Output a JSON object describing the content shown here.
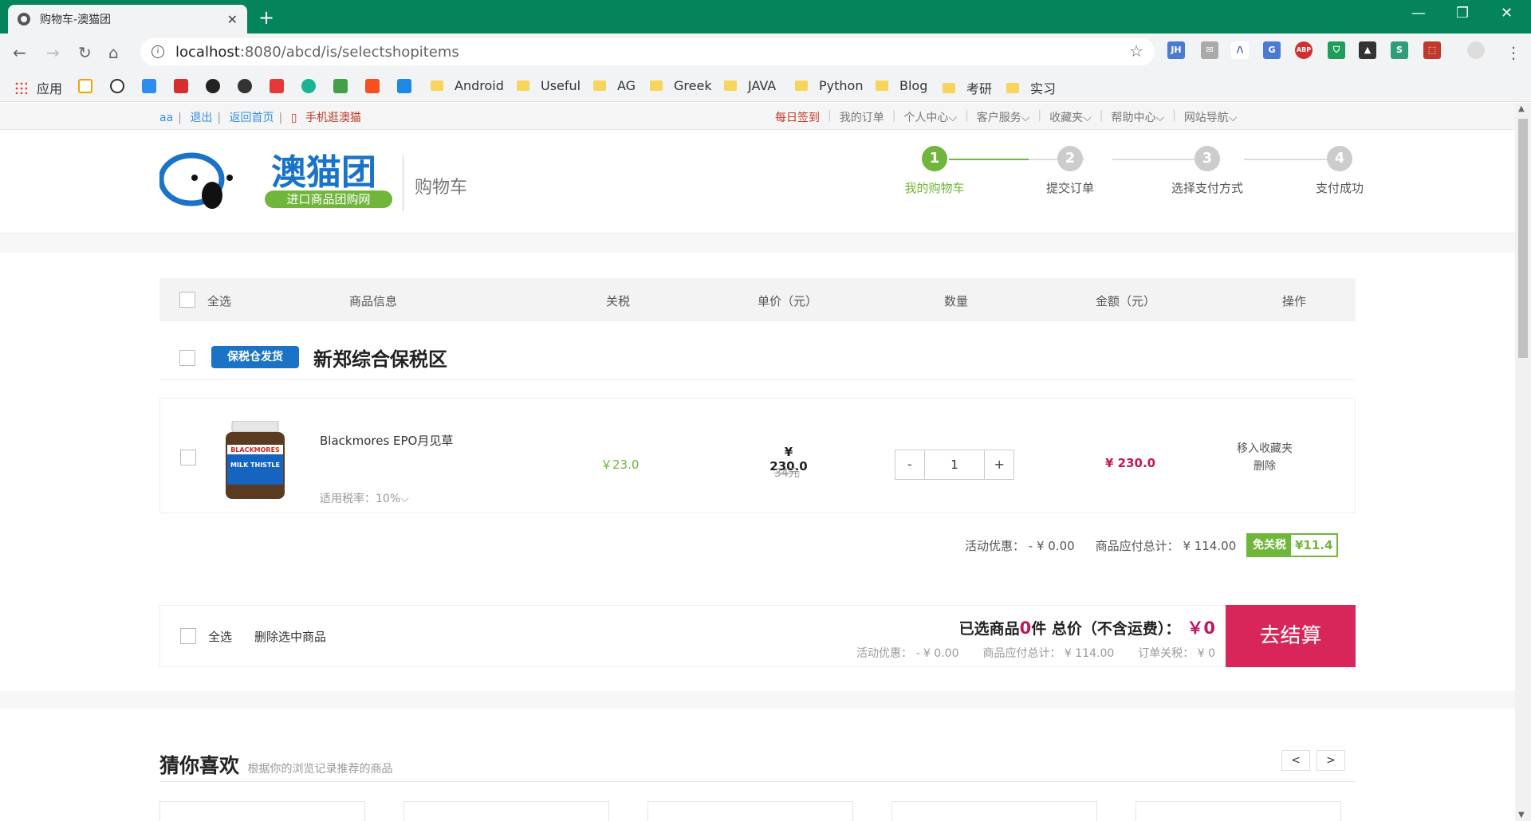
{
  "browser": {
    "tab_title": "购物车-澳猫团",
    "tab_close": "✕",
    "new_tab": "+",
    "url_host": "localhost",
    "url_path": ":8080/abcd/is/selectshopitems",
    "win_min": "—",
    "win_restore": "❐",
    "win_close": "✕",
    "nav_back": "←",
    "nav_forward": "→",
    "nav_reload": "↻",
    "nav_home": "⌂",
    "star": "☆",
    "bookmarks": {
      "apps_label": "应用",
      "folders": [
        "Android",
        "Useful",
        "AG",
        "Greek",
        "JAVA",
        "Python",
        "Blog",
        "考研",
        "实习"
      ]
    },
    "extensions": [
      "JH",
      "✉",
      "/\\",
      "G",
      "ABP",
      "⛉",
      "▲",
      "S",
      "⬚"
    ]
  },
  "topbar": {
    "user": "aa",
    "logout": "退出",
    "home": "返回首页",
    "mobile": "手机逛澳猫",
    "daily_sign": "每日签到",
    "my_orders": "我的订单",
    "personal": "个人中心",
    "service": "客户服务",
    "favorites": "收藏夹",
    "help": "帮助中心",
    "site_nav": "网站导航",
    "dropdown_glyph": "⌵"
  },
  "header": {
    "logo_text": "澳猫团",
    "logo_sub": "进口商品团购网",
    "title": "购物车",
    "steps": [
      {
        "num": "1",
        "label": "我的购物车"
      },
      {
        "num": "2",
        "label": "提交订单"
      },
      {
        "num": "3",
        "label": "选择支付方式"
      },
      {
        "num": "4",
        "label": "支付成功"
      }
    ]
  },
  "cart_head": {
    "select_all": "全选",
    "product_info": "商品信息",
    "tariff": "关税",
    "unit_price": "单价（元）",
    "quantity": "数量",
    "amount": "金额（元）",
    "operation": "操作"
  },
  "store": {
    "badge": "保税仓发货",
    "name": "新郑综合保税区"
  },
  "item": {
    "name": "Blackmores EPO月见草",
    "tax_rate": "适用税率：10%",
    "tariff": "￥23.0",
    "unit_price": "¥ 230.0",
    "old_price": "34元",
    "qty_minus": "-",
    "qty": "1",
    "qty_plus": "+",
    "amount": "¥ 230.0",
    "move_fav": "移入收藏夹",
    "delete": "删除",
    "img_brand": "BLACKMORES",
    "img_product": "MILK THISTLE"
  },
  "store_summary": {
    "discount": "活动优惠： - ¥ 0.00",
    "total": "商品应付总计： ¥ 114.00",
    "tax_free_label": "免关税",
    "tax_free_value": "¥11.4"
  },
  "checkout": {
    "select_all": "全选",
    "delete_selected": "删除选中商品",
    "selected_prefix": "已选商品",
    "selected_count": "0",
    "selected_suffix": "件 总价（不含运费）：",
    "total": "￥0",
    "discount": "活动优惠： - ¥ 0.00",
    "payable": "商品应付总计： ¥ 114.00",
    "order_tax": "订单关税： ¥ 0",
    "pay_button": "去结算"
  },
  "guess": {
    "title": "猜你喜欢",
    "subtitle": "根据你的浏览记录推荐的商品",
    "prev": "<",
    "next": ">"
  },
  "colors": {
    "titlebar": "#03845c",
    "accent_green": "#6fb63b",
    "price_red": "#c2185b",
    "pay_button": "#d8255a",
    "badge_blue": "#1a73c7"
  }
}
